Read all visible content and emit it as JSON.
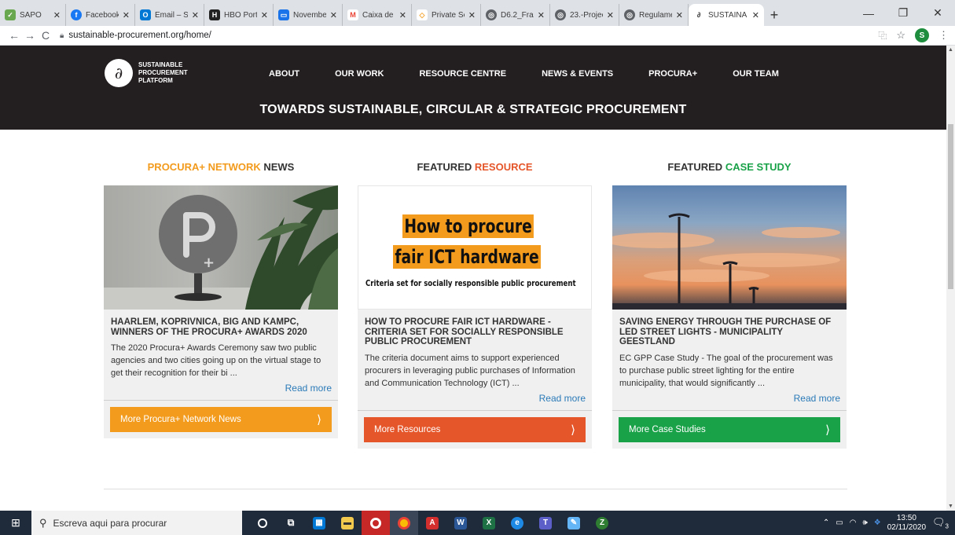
{
  "browser": {
    "tabs": [
      {
        "label": "SAPO",
        "color": "#6aa84f",
        "glyph": "✓"
      },
      {
        "label": "Facebook",
        "color": "#1877f2",
        "glyph": "f"
      },
      {
        "label": "Email – Sc",
        "color": "#0078d4",
        "glyph": "O"
      },
      {
        "label": "HBO Portu",
        "color": "#222222",
        "glyph": "H"
      },
      {
        "label": "Novembe",
        "color": "#1a73e8",
        "glyph": "▭"
      },
      {
        "label": "Caixa de e",
        "color": "#ea4335",
        "glyph": "M"
      },
      {
        "label": "Private Se",
        "color": "#f4a22d",
        "glyph": "◇"
      },
      {
        "label": "D6.2_Fra",
        "color": "#5f6368",
        "glyph": "◎"
      },
      {
        "label": "23.-Projec",
        "color": "#5f6368",
        "glyph": "◎"
      },
      {
        "label": "Regulame",
        "color": "#5f6368",
        "glyph": "◎"
      },
      {
        "label": "SUSTAINA",
        "color": "#ffffff",
        "glyph": "∂",
        "active": true
      }
    ],
    "url": "sustainable-procurement.org/home/",
    "avatar_letter": "S"
  },
  "site": {
    "logo_text": "SUSTAINABLE PROCUREMENT PLATFORM",
    "nav": [
      "ABOUT",
      "OUR WORK",
      "RESOURCE CENTRE",
      "NEWS & EVENTS",
      "PROCURA+",
      "OUR TEAM"
    ],
    "tagline": "TOWARDS SUSTAINABLE, CIRCULAR & STRATEGIC PROCUREMENT"
  },
  "columns": [
    {
      "title_a": "PROCURA+ NETWORK",
      "title_b": " NEWS",
      "heading": "HAARLEM, KOPRIVNICA, BIG AND KAMPC, WINNERS OF THE PROCURA+ AWARDS 2020",
      "excerpt": "The 2020 Procura+ Awards Ceremony saw two public agencies and two cities going up on the virtual stage to get their recognition for their bi ...",
      "read_more": "Read more",
      "button": "More Procura+ Network News",
      "button_color": "#f29b1d"
    },
    {
      "title_a": "FEATURED ",
      "title_b": "RESOURCE",
      "heading": "HOW TO PROCURE FAIR ICT HARDWARE - CRITERIA SET FOR SOCIALLY RESPONSIBLE PUBLIC PROCUREMENT",
      "excerpt": "The criteria document aims to support experienced procurers in leveraging public purchases of Information and Communication Technology (ICT) ...",
      "read_more": "Read more",
      "button": "More Resources",
      "button_color": "#e5562a",
      "cover_line1": "How to procure",
      "cover_line2": "fair ICT hardware",
      "cover_sub": "Criteria set for socially responsible public procurement"
    },
    {
      "title_a": "FEATURED ",
      "title_b": "CASE STUDY",
      "heading": "SAVING ENERGY THROUGH THE PURCHASE OF LED STREET LIGHTS - MUNICIPALITY GEESTLAND",
      "excerpt": "EC GPP Case Study - The goal of the procurement was to purchase public street lighting for the entire municipality, that would significantly ...",
      "read_more": "Read more",
      "button": "More Case Studies",
      "button_color": "#1aa249"
    }
  ],
  "taskbar": {
    "search_placeholder": "Escreva aqui para procurar",
    "time": "13:50",
    "date": "02/11/2020",
    "notif_count": "3"
  }
}
